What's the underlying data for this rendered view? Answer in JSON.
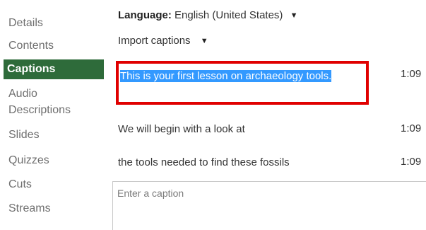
{
  "sidebar": {
    "items": [
      {
        "label": "Details"
      },
      {
        "label": "Contents"
      },
      {
        "label": "Captions"
      },
      {
        "label": "Audio"
      },
      {
        "label": "Descriptions"
      },
      {
        "label": "Slides"
      },
      {
        "label": "Quizzes"
      },
      {
        "label": "Cuts"
      },
      {
        "label": "Streams"
      }
    ],
    "active": "Captions"
  },
  "language": {
    "label": "Language:",
    "value": "English (United States)"
  },
  "import": {
    "label": "Import captions"
  },
  "captions": [
    {
      "text": "This is your first lesson on archaeology tools.",
      "time": "1:09",
      "selected": true
    },
    {
      "text": "We will begin with a look at",
      "time": "1:09"
    },
    {
      "text": "the tools needed to find these fossils",
      "time": "1:09"
    }
  ],
  "caption_input": {
    "placeholder": "Enter a caption"
  },
  "colors": {
    "active_nav_bg": "#2e6b3a",
    "selection": "#3399ff",
    "highlight_border": "#e00000"
  }
}
